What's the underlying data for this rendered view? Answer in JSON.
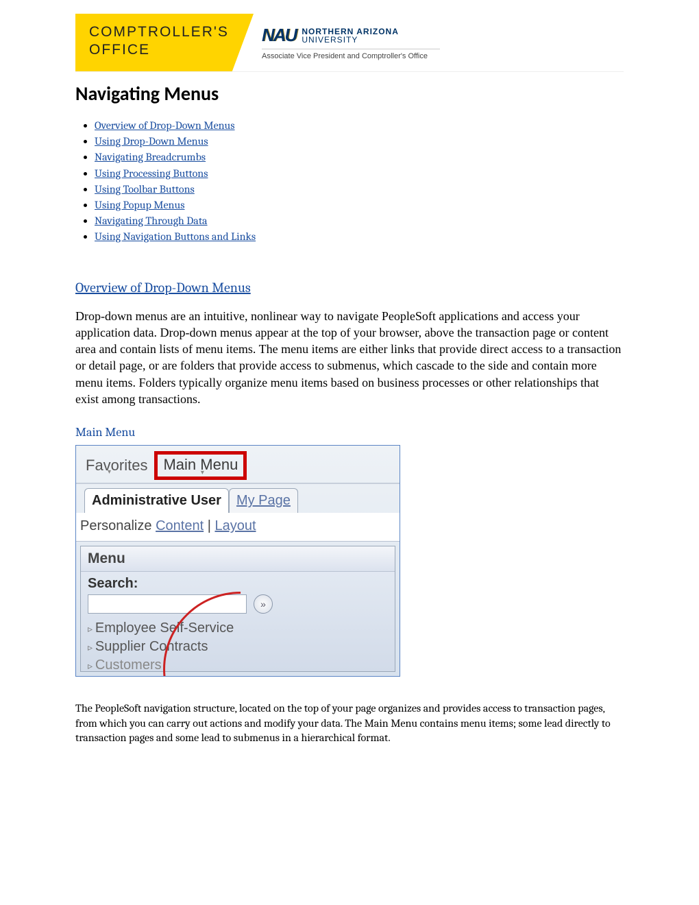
{
  "header": {
    "office_line1": "COMPTROLLER'S",
    "office_line2": "OFFICE",
    "logo_letters": "NAU",
    "logo_name_top": "NORTHERN ARIZONA",
    "logo_name_bot": "UNIVERSITY",
    "subtitle": "Associate Vice President and Comptroller's Office"
  },
  "title": "Navigating Menus",
  "toc": [
    "Overview of Drop-Down Menus",
    "Using Drop-Down Menus",
    "Navigating Breadcrumbs",
    "Using Processing Buttons",
    "Using Toolbar Buttons",
    "Using Popup Menus",
    "Navigating Through Data",
    "Using Navigation Buttons and Links"
  ],
  "section": {
    "heading": "Overview of Drop-Down Menus",
    "body": "Drop-down menus are an intuitive, nonlinear way to navigate PeopleSoft applications and access your application data. Drop-down menus appear at the top of your browser, above the transaction page or content area and contain lists of menu items. The menu items are either links that provide direct access to a transaction or detail page, or are folders that provide access to submenus, which cascade to the side and contain more menu items. Folders typically organize menu items based on business processes or other relationships that exist among transactions.",
    "sub_heading": "Main Menu"
  },
  "figure": {
    "favorites": "Favorites",
    "main_menu": "Main Menu",
    "tab_active": "Administrative User",
    "tab_inactive": "My Page",
    "personalize_label": "Personalize",
    "personalize_link1": "Content",
    "personalize_sep": " | ",
    "personalize_link2": "Layout",
    "menu_label": "Menu",
    "search_label": "Search:",
    "go_icon": "»",
    "items": [
      "Employee Self-Service",
      "Supplier Contracts",
      "Customers"
    ]
  },
  "after_figure": "The PeopleSoft navigation structure, located on the top of your page organizes and provides access to transaction pages, from which you can carry out actions and modify your data. The Main Menu contains menu items; some lead directly to transaction pages and some lead to submenus in a hierarchical format."
}
